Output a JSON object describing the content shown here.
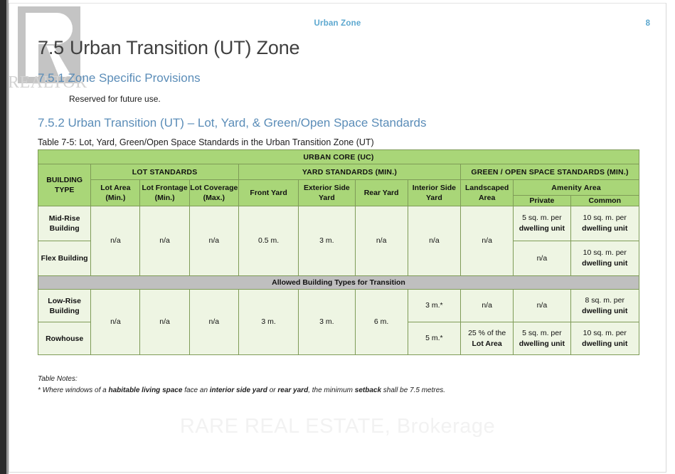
{
  "viewer": {
    "watermark_logo_text": "REALTOR",
    "watermark_bottom_text": "RARE REAL ESTATE, Brokerage"
  },
  "page": {
    "running_header": "Urban Zone",
    "page_number": "8",
    "heading_number": "7.5",
    "heading_title": "Urban Transition (UT) Zone",
    "subheading_1": "7.5.1 Zone Specific Provisions",
    "paragraph_1": "Reserved for future use.",
    "subheading_2": "7.5.2 Urban Transition (UT) – Lot, Yard, & Green/Open Space Standards",
    "table_caption": "Table 7-5: Lot, Yard, Green/Open Space Standards in the Urban Transition Zone (UT)"
  },
  "table": {
    "super_header": "URBAN CORE (UC)",
    "group_headers": {
      "building_type": "BUILDING TYPE",
      "lot_standards": "LOT STANDARDS",
      "yard_standards": "YARD STANDARDS (MIN.)",
      "green_open": "GREEN / OPEN SPACE STANDARDS (MIN.)",
      "amenity_area": "Amenity Area"
    },
    "columns": {
      "lot_area": "Lot Area (Min.)",
      "lot_frontage": "Lot Frontage (Min.)",
      "lot_coverage": "Lot Coverage (Max.)",
      "front_yard": "Front Yard",
      "exterior_side_yard": "Exterior Side Yard",
      "rear_yard": "Rear Yard",
      "interior_side_yard": "Interior Side Yard",
      "landscaped_area": "Landscaped Area",
      "private": "Private",
      "common": "Common"
    },
    "divider_row_label": "Allowed Building Types for Transition",
    "rows": [
      {
        "building_type": "Mid-Rise Building",
        "lot_area": "n/a",
        "lot_frontage": "n/a",
        "lot_coverage": "n/a",
        "front_yard": "0.5 m.",
        "exterior_side_yard": "3 m.",
        "rear_yard": "n/a",
        "interior_side_yard": "n/a",
        "landscaped_area": "n/a",
        "private_amount": "5 sq. m. per",
        "private_unit": "dwelling unit",
        "common_amount": "10 sq. m. per",
        "common_unit": "dwelling unit"
      },
      {
        "building_type": "Flex Building",
        "private_amount": "n/a",
        "private_unit": "",
        "common_amount": "10 sq. m. per",
        "common_unit": "dwelling unit"
      },
      {
        "building_type": "Low-Rise Building",
        "lot_area": "n/a",
        "lot_frontage": "n/a",
        "lot_coverage": "n/a",
        "front_yard": "3 m.",
        "exterior_side_yard": "3 m.",
        "rear_yard": "6 m.",
        "interior_side_yard": "3 m.*",
        "landscaped_area": "n/a",
        "private_amount": "n/a",
        "private_unit": "",
        "common_amount": "8 sq. m. per",
        "common_unit": "dwelling unit"
      },
      {
        "building_type": "Rowhouse",
        "interior_side_yard": "5 m.*",
        "landscaped_amount": "25 % of the",
        "landscaped_unit": "Lot Area",
        "private_amount": "5 sq. m. per",
        "private_unit": "dwelling unit",
        "common_amount": "10 sq. m. per",
        "common_unit": "dwelling unit"
      }
    ],
    "notes_title": "Table Notes:",
    "note_1_pre": "* Where windows of a ",
    "note_1_b1": "habitable living space",
    "note_1_mid1": " face an ",
    "note_1_b2": "interior side yard",
    "note_1_mid2": " or ",
    "note_1_b3": "rear yard",
    "note_1_mid3": ", the minimum ",
    "note_1_b4": "setback",
    "note_1_end": " shall be 7.5 metres."
  },
  "colors": {
    "header_green": "#a9d678",
    "body_green": "#eef5e3",
    "divider_gray": "#bfbfbf",
    "heading_blue": "#5b8db8",
    "running_head_blue": "#5ba7cf"
  }
}
